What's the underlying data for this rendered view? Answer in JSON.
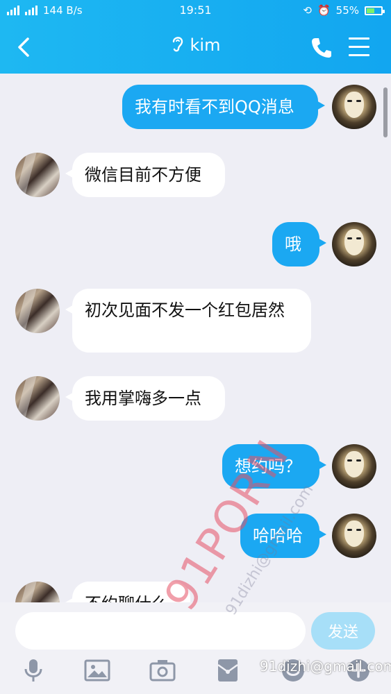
{
  "status_bar": {
    "network": "2G 4G",
    "speed": "144 B/s",
    "time": "19:51",
    "battery": "55%",
    "battery_level": 0.55
  },
  "header": {
    "title": "kim",
    "back_icon": "chevron-left-icon",
    "ear_icon": "ear-icon",
    "phone_icon": "phone-icon",
    "menu_icon": "menu-icon"
  },
  "messages": [
    {
      "sender": "me",
      "text": "我有时看不到QQ消息"
    },
    {
      "sender": "kim",
      "text": "微信目前不方便"
    },
    {
      "sender": "me",
      "text": "哦"
    },
    {
      "sender": "kim",
      "text": "初次见面不发一个红包居然"
    },
    {
      "sender": "kim",
      "text": "我用掌嗨多一点"
    },
    {
      "sender": "me",
      "text": "想约吗？"
    },
    {
      "sender": "me",
      "text": "哈哈哈"
    },
    {
      "sender": "kim",
      "text": "不约聊什么"
    }
  ],
  "input_bar": {
    "placeholder": "",
    "send_label": "发送",
    "tools": [
      "microphone-icon",
      "image-icon",
      "camera-icon",
      "red-packet-icon",
      "emoji-icon",
      "plus-icon"
    ]
  },
  "watermark": {
    "text": "91PORN",
    "email_diagonal": "91dizhi@gmail.com",
    "email_corner": "91dizhi@gmail.com"
  },
  "colors": {
    "header": "#1eb8f2",
    "bubble_me": "#1ba8f2",
    "bubble_kim": "#ffffff",
    "background": "#eeeef5",
    "send_button": "#a7dff8"
  }
}
